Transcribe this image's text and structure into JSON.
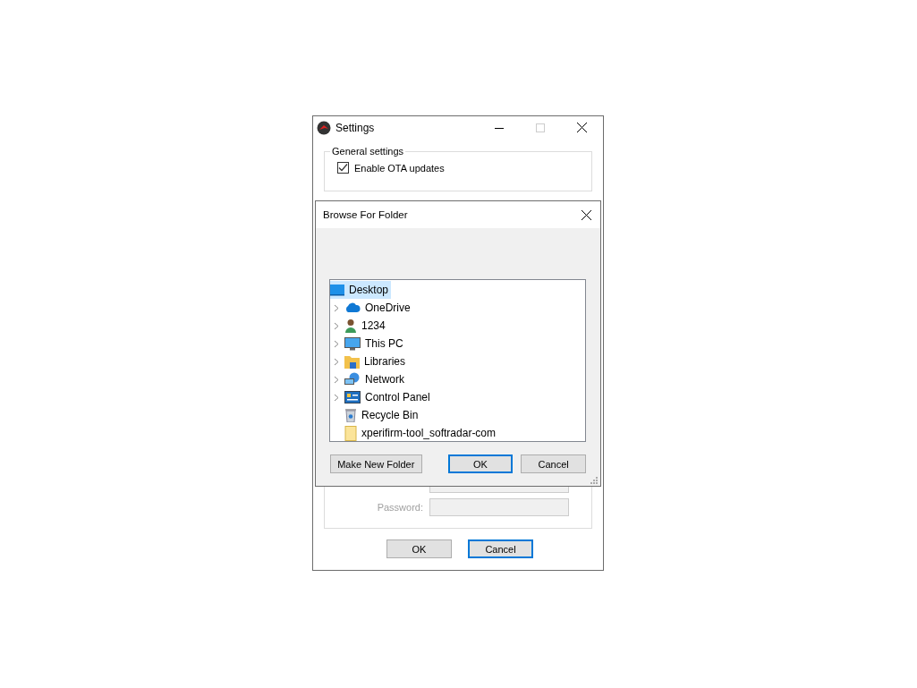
{
  "settings_window": {
    "title": "Settings",
    "general_settings": {
      "legend": "General settings",
      "enable_ota": {
        "label": "Enable OTA updates",
        "checked": true
      }
    },
    "password_label": "Password:",
    "buttons": [
      {
        "label": "OK",
        "default": false
      },
      {
        "label": "Cancel",
        "default": true
      }
    ]
  },
  "browse_dialog": {
    "title": "Browse For Folder",
    "tree": [
      {
        "label": "Desktop",
        "kind": "desktop",
        "selected": true,
        "expandable": false
      },
      {
        "label": "OneDrive",
        "kind": "cloud",
        "selected": false,
        "expandable": true
      },
      {
        "label": "1234",
        "kind": "user",
        "selected": false,
        "expandable": true
      },
      {
        "label": "This PC",
        "kind": "monitor",
        "selected": false,
        "expandable": true
      },
      {
        "label": "Libraries",
        "kind": "library",
        "selected": false,
        "expandable": true
      },
      {
        "label": "Network",
        "kind": "network",
        "selected": false,
        "expandable": true
      },
      {
        "label": "Control Panel",
        "kind": "panel",
        "selected": false,
        "expandable": true
      },
      {
        "label": "Recycle Bin",
        "kind": "bin",
        "selected": false,
        "expandable": false
      },
      {
        "label": "xperifirm-tool_softradar-com",
        "kind": "folder",
        "selected": false,
        "expandable": false
      }
    ],
    "buttons": [
      {
        "label": "Make New Folder",
        "default": false
      },
      {
        "label": "OK",
        "default": true
      },
      {
        "label": "Cancel",
        "default": false
      }
    ]
  }
}
